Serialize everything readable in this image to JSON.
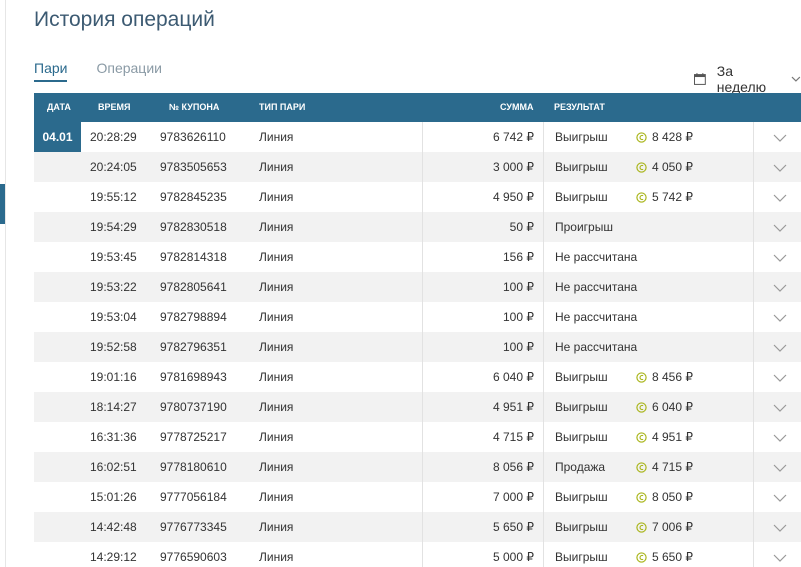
{
  "page": {
    "title": "История операций"
  },
  "tabs": [
    {
      "label": "Пари",
      "active": true
    },
    {
      "label": "Операции",
      "active": false
    }
  ],
  "period": {
    "label": "За неделю"
  },
  "table": {
    "headers": {
      "date": "ДАТА",
      "time": "ВРЕМЯ",
      "coupon": "№ КУПОНА",
      "type": "ТИП ПАРИ",
      "sum": "СУММА",
      "result": "РЕЗУЛЬТАТ"
    },
    "date_group": "04.01",
    "rows": [
      {
        "time": "20:28:29",
        "coupon": "9783626110",
        "type": "Линия",
        "sum": "6 742 ₽",
        "result": "Выигрыш",
        "payout": "8 428 ₽"
      },
      {
        "time": "20:24:05",
        "coupon": "9783505653",
        "type": "Линия",
        "sum": "3 000 ₽",
        "result": "Выигрыш",
        "payout": "4 050 ₽"
      },
      {
        "time": "19:55:12",
        "coupon": "9782845235",
        "type": "Линия",
        "sum": "4 950 ₽",
        "result": "Выигрыш",
        "payout": "5 742 ₽"
      },
      {
        "time": "19:54:29",
        "coupon": "9782830518",
        "type": "Линия",
        "sum": "50 ₽",
        "result": "Проигрыш",
        "payout": ""
      },
      {
        "time": "19:53:45",
        "coupon": "9782814318",
        "type": "Линия",
        "sum": "156 ₽",
        "result": "Не рассчитана",
        "payout": ""
      },
      {
        "time": "19:53:22",
        "coupon": "9782805641",
        "type": "Линия",
        "sum": "100 ₽",
        "result": "Не рассчитана",
        "payout": ""
      },
      {
        "time": "19:53:04",
        "coupon": "9782798894",
        "type": "Линия",
        "sum": "100 ₽",
        "result": "Не рассчитана",
        "payout": ""
      },
      {
        "time": "19:52:58",
        "coupon": "9782796351",
        "type": "Линия",
        "sum": "100 ₽",
        "result": "Не рассчитана",
        "payout": ""
      },
      {
        "time": "19:01:16",
        "coupon": "9781698943",
        "type": "Линия",
        "sum": "6 040 ₽",
        "result": "Выигрыш",
        "payout": "8 456 ₽"
      },
      {
        "time": "18:14:27",
        "coupon": "9780737190",
        "type": "Линия",
        "sum": "4 951 ₽",
        "result": "Выигрыш",
        "payout": "6 040 ₽"
      },
      {
        "time": "16:31:36",
        "coupon": "9778725217",
        "type": "Линия",
        "sum": "4 715 ₽",
        "result": "Выигрыш",
        "payout": "4 951 ₽"
      },
      {
        "time": "16:02:51",
        "coupon": "9778180610",
        "type": "Линия",
        "sum": "8 056 ₽",
        "result": "Продажа",
        "payout": "4 715 ₽"
      },
      {
        "time": "15:01:26",
        "coupon": "9777056184",
        "type": "Линия",
        "sum": "7 000 ₽",
        "result": "Выигрыш",
        "payout": "8 050 ₽"
      },
      {
        "time": "14:42:48",
        "coupon": "9776773345",
        "type": "Линия",
        "sum": "5 650 ₽",
        "result": "Выигрыш",
        "payout": "7 006 ₽"
      },
      {
        "time": "14:29:12",
        "coupon": "9776590603",
        "type": "Линия",
        "sum": "5 000 ₽",
        "result": "Выигрыш",
        "payout": "5 650 ₽"
      }
    ]
  },
  "icons": {
    "calendar": "calendar-icon",
    "coin": "coin-icon",
    "expand": "chevron-down-icon"
  },
  "colors": {
    "accent": "#2b6a8d",
    "coin": "#a8b418"
  }
}
